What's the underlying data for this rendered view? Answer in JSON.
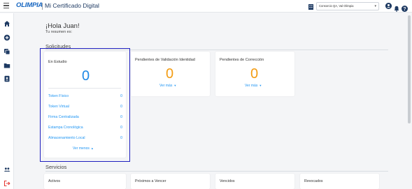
{
  "header": {
    "logo_text": "OLIMPIA",
    "app_title": "Mi Certificado Digital",
    "company_select": "Consorcio QA, Val Olimpia",
    "icons": [
      "menu-icon",
      "building-icon",
      "user-icon",
      "bell-icon",
      "help-icon"
    ]
  },
  "sidebar": {
    "icons": [
      "home-icon",
      "add-icon",
      "copy-icon",
      "folder-icon",
      "contacts-icon",
      "users-icon",
      "logout-icon"
    ]
  },
  "greeting": {
    "title": "¡Hola Juan!",
    "subtitle": "Tu resumen es:"
  },
  "solicitudes": {
    "section_title": "Solicitudes",
    "en_estudio": {
      "title": "En Estudio",
      "count": "0",
      "rows": [
        {
          "label": "Token Físico",
          "value": "0"
        },
        {
          "label": "Token Virtual",
          "value": "0"
        },
        {
          "label": "Firma Centralizada",
          "value": "0"
        },
        {
          "label": "Estampa Cronológica",
          "value": "0"
        },
        {
          "label": "Almacenamiento Local",
          "value": "0"
        }
      ],
      "toggle_label": "Ver menos"
    },
    "pendientes_validacion": {
      "title": "Pendientes de Validación Identidad",
      "count": "0",
      "toggle_label": "Ver más"
    },
    "pendientes_correccion": {
      "title": "Pendientes de Corrección",
      "count": "0",
      "toggle_label": "Ver más"
    }
  },
  "servicios": {
    "section_title": "Servicios",
    "cards": [
      {
        "title": "Activos"
      },
      {
        "title": "Próximos a Vencer"
      },
      {
        "title": "Vencidos"
      },
      {
        "title": "Revocados"
      }
    ]
  },
  "colors": {
    "accent_blue": "#2196f3",
    "big_number_blue": "#1e88e5",
    "big_number_orange": "#f39c12",
    "nav_dark": "#1f3b63",
    "highlight_border": "#1f1fbf",
    "logout_red": "#e53935"
  }
}
